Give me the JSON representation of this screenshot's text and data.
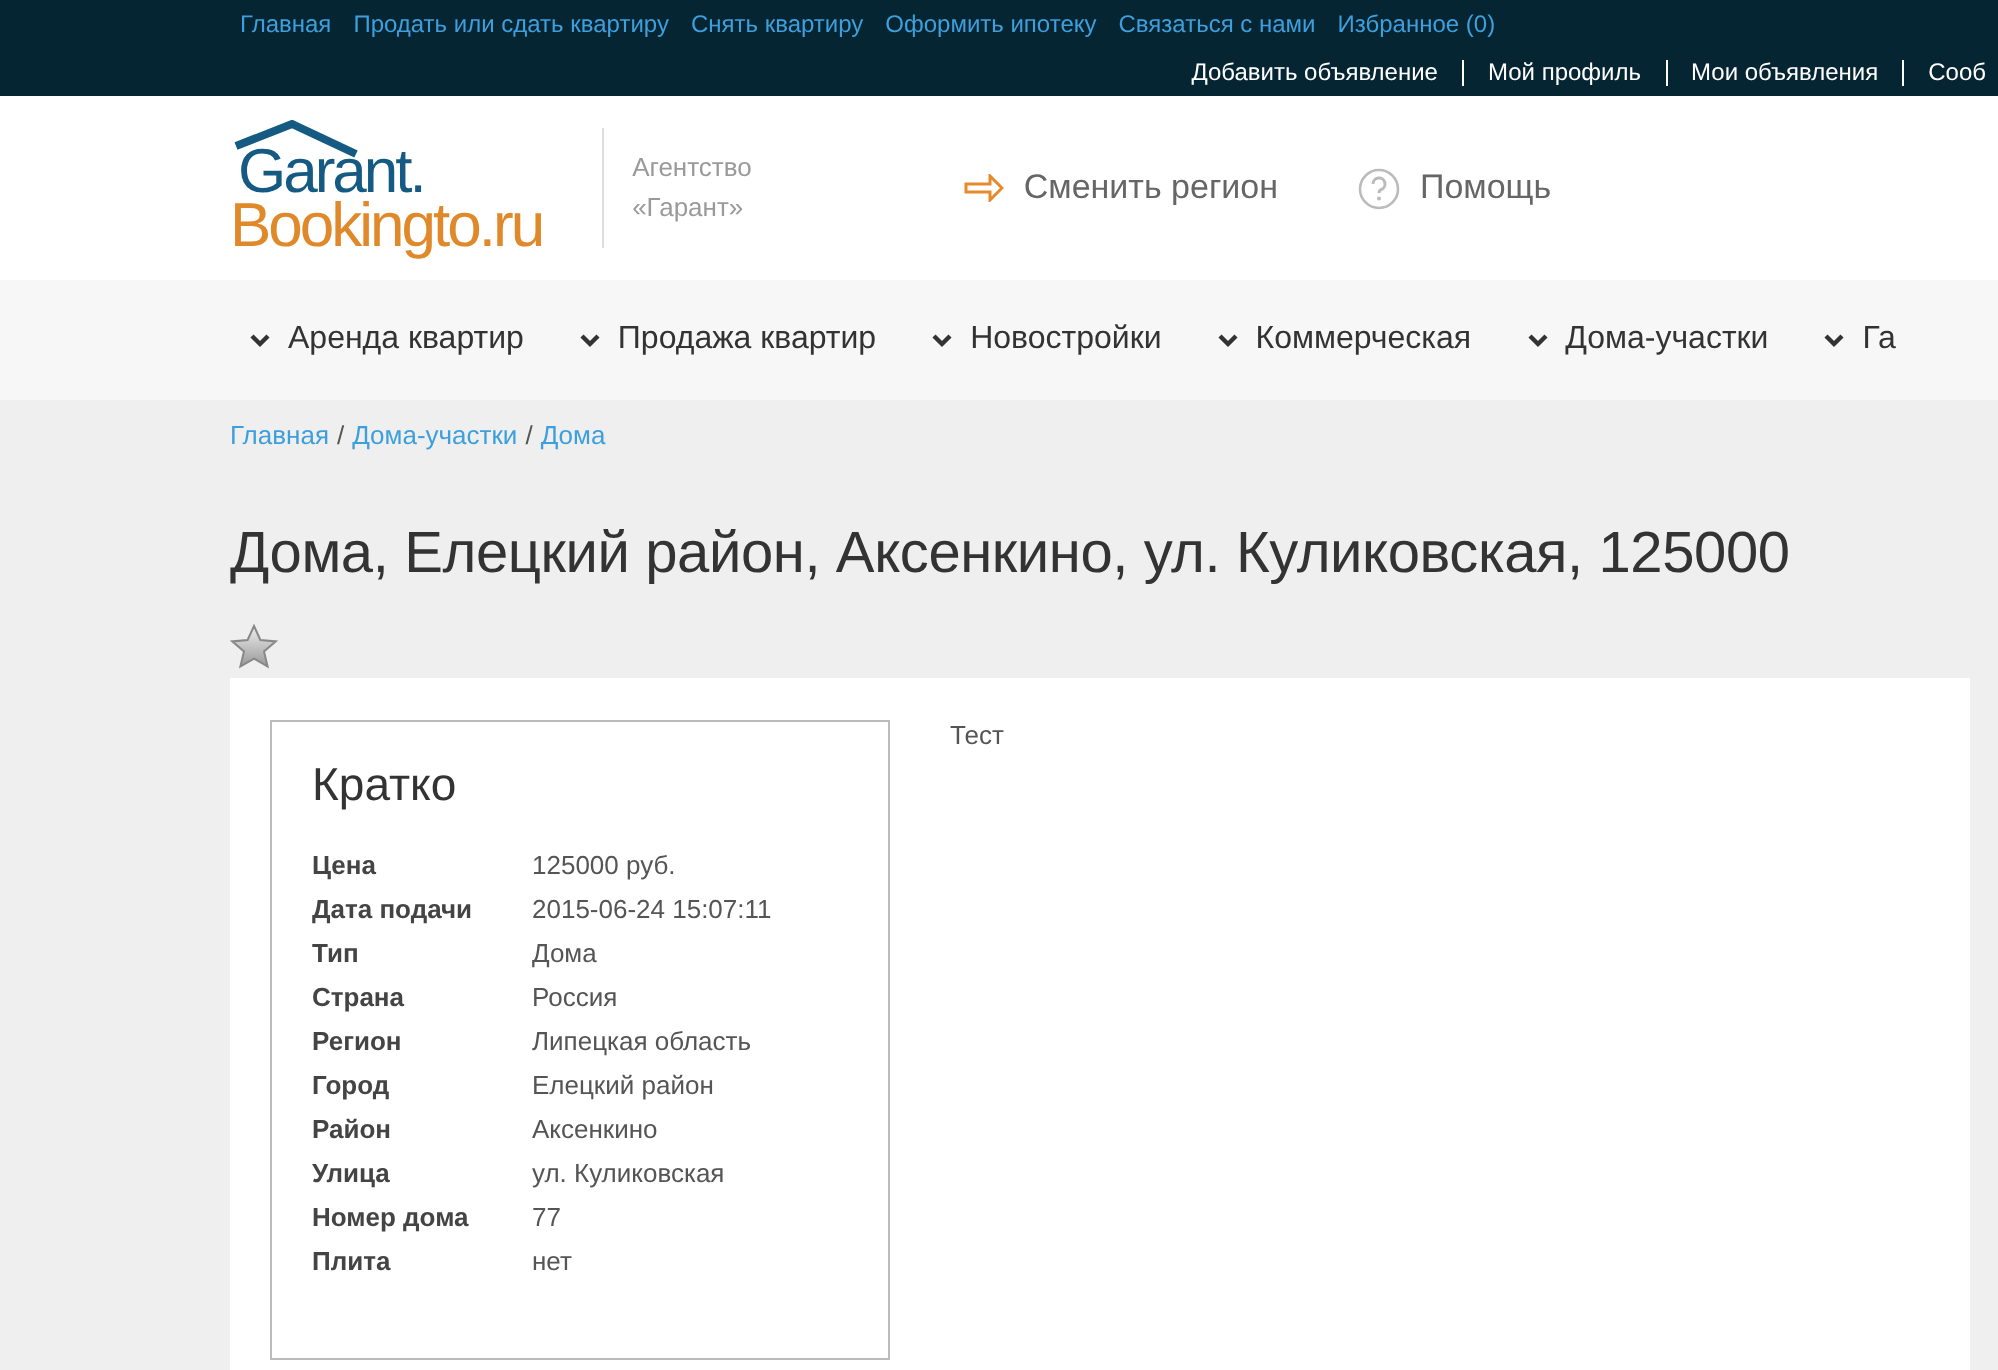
{
  "top_links": [
    "Главная",
    "Продать или сдать квартиру",
    "Снять квартиру",
    "Оформить ипотеку",
    "Связаться с нами",
    "Избранное (0)"
  ],
  "user_links": [
    "Добавить объявление",
    "Мой профиль",
    "Мои объявления",
    "Сооб"
  ],
  "logo": {
    "line_1": "Garant.",
    "line_2": "Bookingto.ru"
  },
  "agency": [
    "Агентство",
    "«Гарант»"
  ],
  "header_actions": [
    {
      "kind": "region",
      "label": "Сменить регион"
    },
    {
      "kind": "help",
      "label": "Помощь"
    }
  ],
  "menu": [
    "Аренда квартир",
    "Продажа квартир",
    "Новостройки",
    "Коммерческая",
    "Дома-участки",
    "Га"
  ],
  "breadcrumbs": [
    "Главная",
    "Дома-участки",
    "Дома"
  ],
  "breadcrumb_separator": "/",
  "title": "Дома, Елецкий район, Аксенкино, ул. Куликовская, 125000",
  "summary": {
    "heading": "Кратко",
    "rows": [
      {
        "label": "Цена",
        "value": "125000 руб."
      },
      {
        "label": "Дата подачи",
        "value": "2015-06-24 15:07:11"
      },
      {
        "label": "Тип",
        "value": "Дома"
      },
      {
        "label": "Страна",
        "value": "Россия"
      },
      {
        "label": "Регион",
        "value": "Липецкая область"
      },
      {
        "label": "Город",
        "value": "Елецкий район"
      },
      {
        "label": "Район",
        "value": "Аксенкино"
      },
      {
        "label": "Улица",
        "value": "ул. Куликовская"
      },
      {
        "label": "Номер дома",
        "value": "77"
      },
      {
        "label": "Плита",
        "value": "нет"
      }
    ]
  },
  "description": "Тест"
}
